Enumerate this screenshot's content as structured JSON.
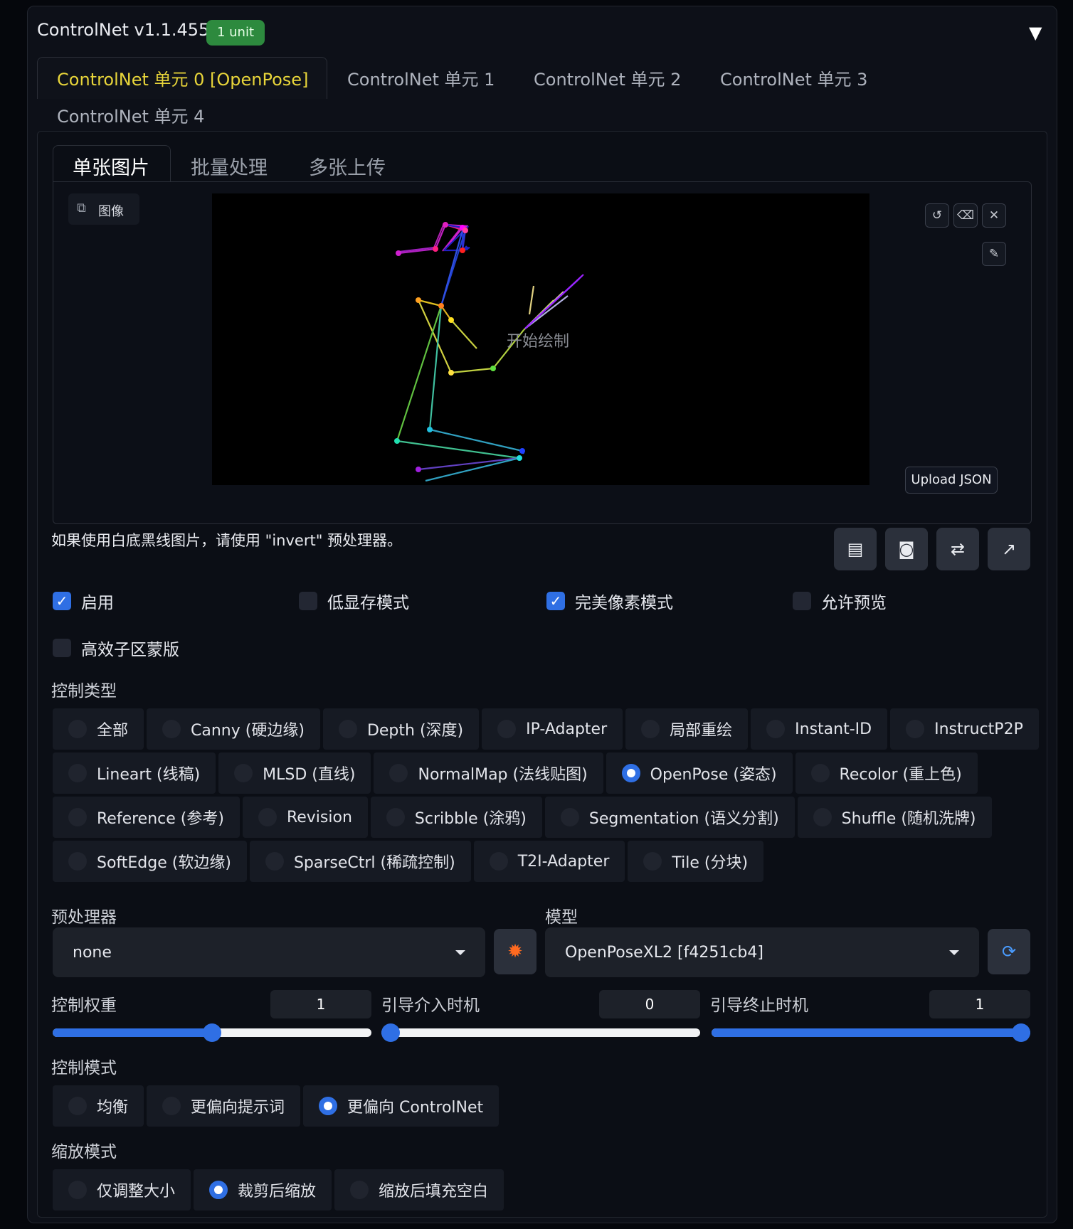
{
  "header": {
    "title": "ControlNet v1.1.455",
    "badge": "1 unit",
    "collapse_icon": "triangle-down-icon"
  },
  "unit_tabs": [
    {
      "label": "ControlNet 单元 0 [OpenPose]",
      "active": true
    },
    {
      "label": "ControlNet 单元 1",
      "active": false
    },
    {
      "label": "ControlNet 单元 2",
      "active": false
    },
    {
      "label": "ControlNet 单元 3",
      "active": false
    },
    {
      "label": "ControlNet 单元 4",
      "active": false
    }
  ],
  "input_tabs": [
    {
      "label": "单张图片",
      "active": true
    },
    {
      "label": "批量处理",
      "active": false
    },
    {
      "label": "多张上传",
      "active": false
    }
  ],
  "image_panel": {
    "label": "图像",
    "canvas_overlay": "开始绘制",
    "upload_json": "Upload JSON",
    "icons": [
      "undo-icon",
      "eraser-icon",
      "close-icon",
      "brush-icon"
    ]
  },
  "hint": "如果使用白底黑线图片，请使用 \"invert\" 预处理器。",
  "action_buttons": [
    "new-canvas-icon",
    "camera-icon",
    "swap-icon",
    "send-dimensions-icon"
  ],
  "checkboxes": [
    {
      "label": "启用",
      "checked": true
    },
    {
      "label": "低显存模式",
      "checked": false
    },
    {
      "label": "完美像素模式",
      "checked": true
    },
    {
      "label": "允许预览",
      "checked": false
    },
    {
      "label": "高效子区蒙版",
      "checked": false
    }
  ],
  "control_type": {
    "label": "控制类型",
    "rows": [
      [
        "全部",
        "Canny (硬边缘)",
        "Depth (深度)",
        "IP-Adapter",
        "局部重绘",
        "Instant-ID",
        "InstructP2P"
      ],
      [
        "Lineart (线稿)",
        "MLSD (直线)",
        "NormalMap (法线贴图)",
        "OpenPose (姿态)",
        "Recolor (重上色)"
      ],
      [
        "Reference (参考)",
        "Revision",
        "Scribble (涂鸦)",
        "Segmentation (语义分割)",
        "Shuffle (随机洗牌)"
      ],
      [
        "SoftEdge (软边缘)",
        "SparseCtrl (稀疏控制)",
        "T2I-Adapter",
        "Tile (分块)"
      ]
    ],
    "selected": "OpenPose (姿态)"
  },
  "preprocessor": {
    "label": "预处理器",
    "value": "none"
  },
  "model": {
    "label": "模型",
    "value": "OpenPoseXL2 [f4251cb4]"
  },
  "sliders": [
    {
      "label": "控制权重",
      "value": "1",
      "fraction": 0.5
    },
    {
      "label": "引导介入时机",
      "value": "0",
      "fraction": 0
    },
    {
      "label": "引导终止时机",
      "value": "1",
      "fraction": 1
    }
  ],
  "control_mode": {
    "label": "控制模式",
    "options": [
      "均衡",
      "更偏向提示词",
      "更偏向 ControlNet"
    ],
    "selected": "更偏向 ControlNet"
  },
  "resize_mode": {
    "label": "缩放模式",
    "options": [
      "仅调整大小",
      "裁剪后缩放",
      "缩放后填充空白"
    ],
    "selected": "裁剪后缩放"
  },
  "colors": {
    "accent": "#2f6fe4",
    "active_tab": "#e8d53a",
    "badge": "#2d8a3e"
  }
}
